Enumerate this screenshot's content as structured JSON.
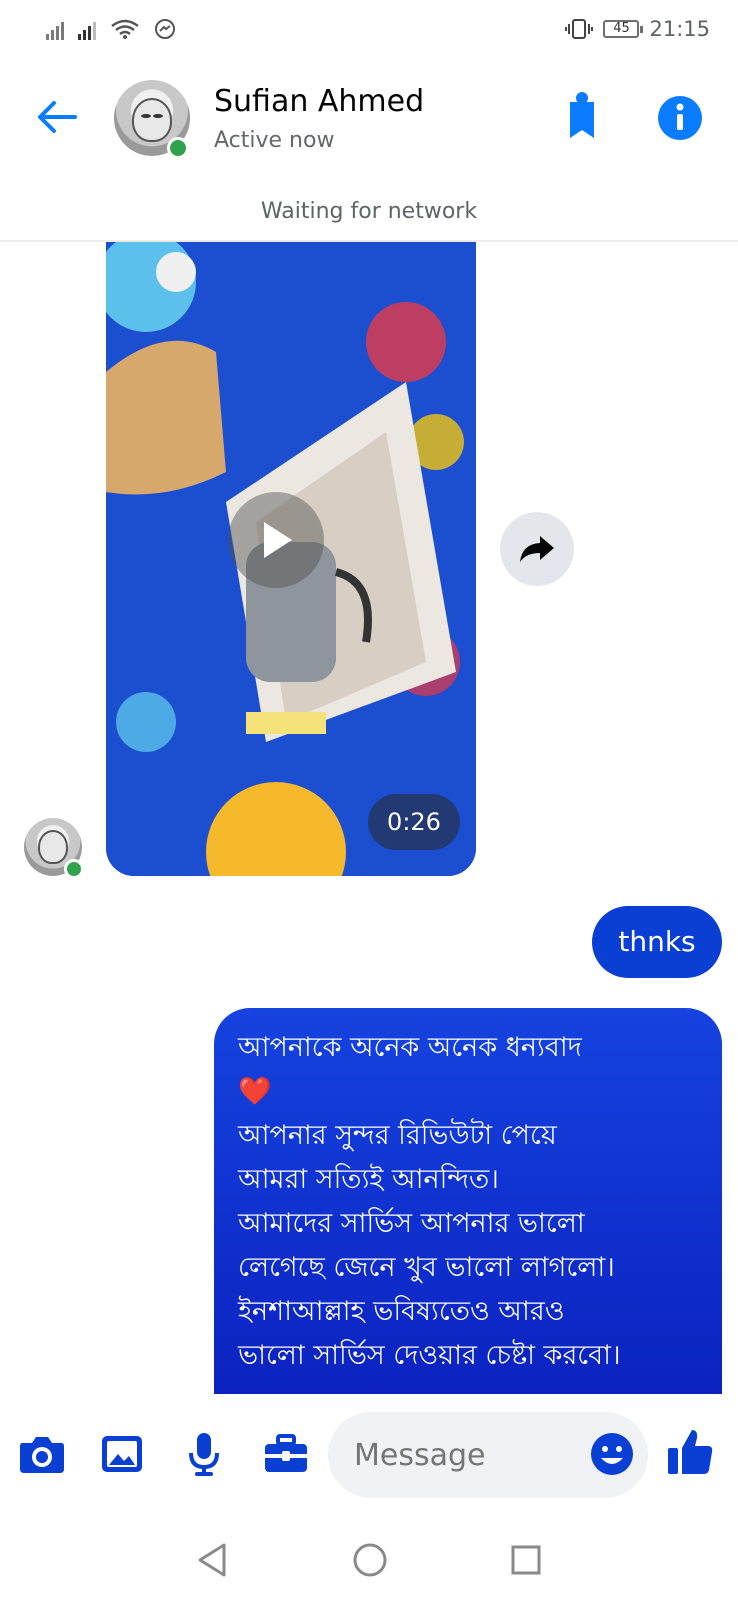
{
  "status_bar": {
    "time": "21:15",
    "battery": "45"
  },
  "header": {
    "contact_name": "Sufian Ahmed",
    "contact_status": "Active now"
  },
  "network_banner": "Waiting for network",
  "video_message": {
    "duration": "0:26"
  },
  "messages": [
    {
      "text": "thnks"
    },
    {
      "text": "আপনাকে অনেক অনেক ধন্যবাদ\n❤️\nআপনার সুন্দর রিভিউটা পেয়ে\nআমরা সত্যিই আনন্দিত।\nআমাদের সার্ভিস আপনার ভালো\nলেগেছে জেনে খুব ভালো লাগলো।\nইনশাআল্লাহ ভবিষ্যতেও আরও\nভালো সার্ভিস দেওয়ার চেষ্টা করবো।"
    }
  ],
  "composer": {
    "placeholder": "Message"
  },
  "colors": {
    "accent": "#0a7cff",
    "active": "#31a24c",
    "bubble": "#0b22c0"
  },
  "icons": [
    "back-arrow-icon",
    "phone-icon",
    "info-icon",
    "play-icon",
    "forward-icon",
    "camera-icon",
    "image-icon",
    "microphone-icon",
    "briefcase-icon",
    "emoji-icon",
    "thumbs-up-icon"
  ]
}
